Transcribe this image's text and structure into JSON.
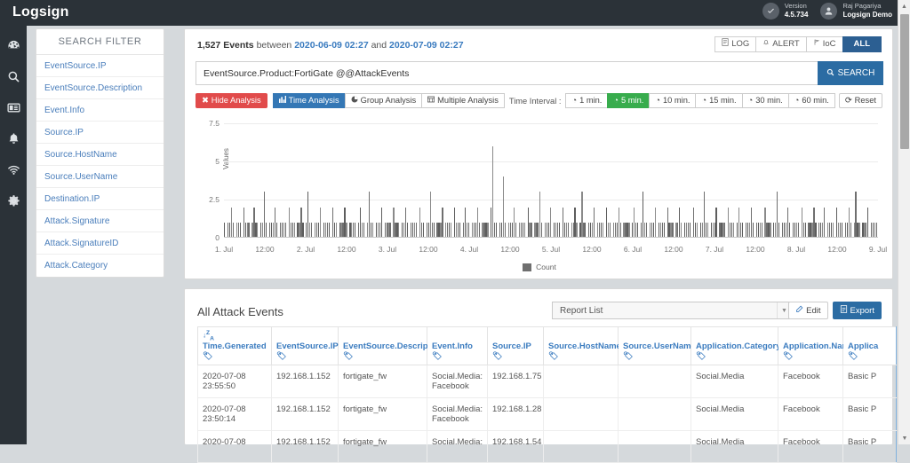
{
  "topbar": {
    "brand": "Logsign",
    "version_label": "Version",
    "version_value": "4.5.734",
    "user_name": "Raj Pagariya",
    "user_org": "Logsign Demo",
    "version_icon": "check-circle-icon",
    "user_icon": "user-icon"
  },
  "rail": {
    "items": [
      {
        "icon": "dashboard-icon",
        "name": "sidebar-item-dashboard"
      },
      {
        "icon": "search-icon",
        "name": "sidebar-item-search"
      },
      {
        "icon": "report-icon",
        "name": "sidebar-item-reports"
      },
      {
        "icon": "bell-icon",
        "name": "sidebar-item-alerts"
      },
      {
        "icon": "wifi-icon",
        "name": "sidebar-item-network"
      },
      {
        "icon": "gear-icon",
        "name": "sidebar-item-settings"
      }
    ]
  },
  "filter": {
    "title": "SEARCH FILTER",
    "items": [
      "EventSource.IP",
      "EventSource.Description",
      "Event.Info",
      "Source.IP",
      "Source.HostName",
      "Source.UserName",
      "Destination.IP",
      "Attack.Signature",
      "Attack.SignatureID",
      "Attack.Category"
    ]
  },
  "search_panel": {
    "event_count": "1,527 Events",
    "between_word": "between",
    "date_from": "2020-06-09 02:27",
    "and_word": "and",
    "date_to": "2020-07-09 02:27",
    "type_buttons": [
      {
        "label": "LOG",
        "icon": "document-icon",
        "active": false
      },
      {
        "label": "ALERT",
        "icon": "bell-icon",
        "active": false
      },
      {
        "label": "IoC",
        "icon": "flag-icon",
        "active": false
      },
      {
        "label": "ALL",
        "icon": "",
        "active": true
      }
    ],
    "query_value": "EventSource.Product:FortiGate @@AttackEvents",
    "query_placeholder": "Search query",
    "search_button": "SEARCH",
    "search_icon": "search-icon"
  },
  "toolbar": {
    "hide_analysis": "Hide Analysis",
    "hide_analysis_icon": "close-icon",
    "time_analysis": "Time Analysis",
    "time_analysis_icon": "bar-chart-icon",
    "group_analysis": "Group Analysis",
    "group_analysis_icon": "pie-chart-icon",
    "multiple_analysis": "Multiple Analysis",
    "multiple_analysis_icon": "table-icon",
    "interval_label": "Time Interval :",
    "intervals": [
      {
        "label": "1 min.",
        "active": false
      },
      {
        "label": "5 min.",
        "active": true
      },
      {
        "label": "10 min.",
        "active": false
      },
      {
        "label": "15 min.",
        "active": false
      },
      {
        "label": "30 min.",
        "active": false
      },
      {
        "label": "60 min.",
        "active": false
      }
    ],
    "reset": "Reset",
    "reset_icon": "refresh-icon",
    "clock_icon": "clock-icon"
  },
  "chart_data": {
    "type": "bar",
    "title": "",
    "xlabel": "",
    "ylabel": "Values",
    "ylim": [
      0,
      7.5
    ],
    "yticks": [
      0,
      2.5,
      5,
      7.5
    ],
    "grid": true,
    "legend_position": "bottom",
    "series": [
      {
        "name": "Count",
        "color": "#6f6f6f"
      }
    ],
    "xticks": [
      "1. Jul",
      "12:00",
      "2. Jul",
      "12:00",
      "3. Jul",
      "12:00",
      "4. Jul",
      "12:00",
      "5. Jul",
      "12:00",
      "6. Jul",
      "12:00",
      "7. Jul",
      "12:00",
      "8. Jul",
      "12:00",
      "9. Jul"
    ],
    "x_range": [
      "2020-07-01 00:00",
      "2020-07-09 00:00"
    ],
    "bin_minutes": 5,
    "note": "Dense 5-minute bin counts; most bins 0-1, frequent bars at 1-2, scattered spikes 2.5-3, isolated peaks up to 6.1",
    "values": [
      1,
      0,
      1,
      1,
      2,
      1,
      0,
      1,
      1,
      1,
      0,
      2,
      1,
      1,
      1,
      0,
      1,
      2,
      1,
      1,
      0,
      1,
      1,
      3,
      1,
      0,
      1,
      1,
      1,
      2,
      1,
      0,
      1,
      1,
      1,
      1,
      0,
      2,
      1,
      1,
      1,
      0,
      1,
      1,
      2,
      1,
      0,
      1,
      3,
      1,
      1,
      0,
      1,
      1,
      1,
      2,
      0,
      1,
      1,
      1,
      1,
      0,
      2,
      1,
      1,
      0,
      1,
      1,
      1,
      2,
      1,
      0,
      1,
      1,
      1,
      1,
      0,
      1,
      2,
      1,
      1,
      0,
      1,
      3,
      1,
      1,
      0,
      1,
      1,
      1,
      2,
      0,
      1,
      1,
      1,
      1,
      0,
      2,
      1,
      1,
      1,
      0,
      1,
      1,
      2,
      1,
      0,
      1,
      1,
      1,
      1,
      0,
      2,
      1,
      1,
      0,
      1,
      1,
      3,
      1,
      1,
      0,
      1,
      1,
      1,
      2,
      0,
      1,
      1,
      1,
      1,
      0,
      2,
      1,
      1,
      1,
      0,
      1,
      2,
      1,
      1,
      0,
      1,
      1,
      1,
      2,
      1,
      0,
      1,
      1,
      1,
      1,
      0,
      2,
      6,
      1,
      1,
      0,
      1,
      1,
      4,
      1,
      0,
      1,
      1,
      1,
      2,
      1,
      0,
      1,
      1,
      1,
      1,
      0,
      2,
      1,
      1,
      0,
      1,
      1,
      1,
      3,
      1,
      0,
      1,
      1,
      1,
      2,
      0,
      1,
      1,
      1,
      1,
      0,
      2,
      1,
      1,
      1,
      0,
      1,
      1,
      2,
      1,
      0,
      1,
      3,
      1,
      1,
      0,
      1,
      1,
      1,
      2,
      0,
      1,
      1,
      1,
      1,
      0,
      2,
      1,
      1,
      0,
      1,
      1,
      1,
      2,
      1,
      0,
      1,
      1,
      1,
      1,
      0,
      1,
      2,
      1,
      1,
      0,
      1,
      3,
      1,
      1,
      0,
      1,
      1,
      1,
      2,
      0,
      1,
      1,
      1,
      1,
      0,
      2,
      1,
      1,
      1,
      0,
      1,
      1,
      2,
      1,
      0,
      1,
      1,
      1,
      1,
      0,
      2,
      1,
      1,
      0,
      1,
      1,
      3,
      1,
      1,
      0,
      1,
      1,
      1,
      2,
      0,
      1,
      1,
      1,
      1,
      0,
      2,
      1,
      1,
      1,
      0,
      1,
      2,
      1,
      1,
      0,
      1,
      1,
      1,
      2,
      1,
      0,
      1,
      1,
      1,
      1,
      0,
      2,
      1,
      1,
      1,
      0,
      1,
      1,
      3,
      1,
      0,
      1,
      1,
      1,
      2,
      1,
      0,
      1,
      1,
      1,
      1,
      0,
      2,
      1,
      1,
      0,
      1,
      1,
      1,
      2,
      1,
      0,
      1,
      1,
      1,
      2,
      0,
      1,
      1,
      1,
      1,
      0,
      2,
      1,
      1,
      1,
      0,
      1,
      1,
      2,
      1,
      0,
      1,
      3,
      1,
      1,
      0,
      1,
      1,
      1,
      2,
      0,
      1,
      1,
      1,
      1
    ]
  },
  "table_panel": {
    "title": "All Attack Events",
    "report_select_value": "Report List",
    "edit_button": "Edit",
    "edit_icon": "pencil-icon",
    "export_button": "Export",
    "export_icon": "export-icon",
    "sort_icon": "sort-desc-icon",
    "tag_icon": "tag-icon",
    "columns": [
      "Time.Generated",
      "EventSource.IP",
      "EventSource.Description",
      "Event.Info",
      "Source.IP",
      "Source.HostName",
      "Source.UserName",
      "Application.Category",
      "Application.Name",
      "Applica"
    ],
    "rows": [
      {
        "time": "2020-07-08 23:55:50",
        "eventsource_ip": "192.168.1.152",
        "eventsource_description": "fortigate_fw",
        "event_info": "Social.Media: Facebook",
        "source_ip": "192.168.1.75",
        "source_hostname": "",
        "source_username": "",
        "application_category": "Social.Media",
        "application_name": "Facebook",
        "application_extra": "Basic P"
      },
      {
        "time": "2020-07-08 23:50:14",
        "eventsource_ip": "192.168.1.152",
        "eventsource_description": "fortigate_fw",
        "event_info": "Social.Media: Facebook",
        "source_ip": "192.168.1.28",
        "source_hostname": "",
        "source_username": "",
        "application_category": "Social.Media",
        "application_name": "Facebook",
        "application_extra": "Basic P"
      },
      {
        "time": "2020-07-08",
        "eventsource_ip": "192.168.1.152",
        "eventsource_description": "fortigate_fw",
        "event_info": "Social.Media:",
        "source_ip": "192.168.1.54",
        "source_hostname": "",
        "source_username": "",
        "application_category": "Social.Media",
        "application_name": "Facebook",
        "application_extra": "Basic P"
      }
    ]
  },
  "colors": {
    "brand_dark": "#2b3238",
    "accent_blue": "#2b6ca3",
    "link_blue": "#3a7bbf",
    "danger_red": "#e14b4b",
    "success_green": "#38ac4d",
    "bar_gray": "#6f6f6f"
  }
}
